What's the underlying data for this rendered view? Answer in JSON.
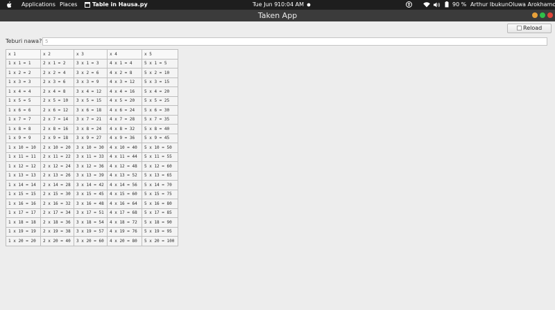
{
  "topbar": {
    "applications": "Applications",
    "places": "Places",
    "active_app": "Table in Hausa.py",
    "date": "Tue Jun 9",
    "time": "10:04 AM",
    "battery": "90 %",
    "user": "Arthur IbukunOluwa Arokhamoni"
  },
  "window": {
    "title": "Taken App",
    "buttons": [
      {
        "name": "minimize",
        "color": "#e8a13a"
      },
      {
        "name": "maximize",
        "color": "#2fbf4a"
      },
      {
        "name": "close",
        "color": "#e0463a"
      }
    ]
  },
  "toolbar": {
    "reload_label": "Reload"
  },
  "form": {
    "label": "Teburi nawa?:",
    "value": "5"
  },
  "table": {
    "headers": [
      "x 1",
      "x 2",
      "x 3",
      "x 4",
      "x 5"
    ],
    "rows": [
      [
        "1 x 1 = 1",
        "2 x 1 = 2",
        "3 x 1 = 3",
        "4 x 1 = 4",
        "5 x 1 = 5"
      ],
      [
        "1 x 2 = 2",
        "2 x 2 = 4",
        "3 x 2 = 6",
        "4 x 2 = 8",
        "5 x 2 = 10"
      ],
      [
        "1 x 3 = 3",
        "2 x 3 = 6",
        "3 x 3 = 9",
        "4 x 3 = 12",
        "5 x 3 = 15"
      ],
      [
        "1 x 4 = 4",
        "2 x 4 = 8",
        "3 x 4 = 12",
        "4 x 4 = 16",
        "5 x 4 = 20"
      ],
      [
        "1 x 5 = 5",
        "2 x 5 = 10",
        "3 x 5 = 15",
        "4 x 5 = 20",
        "5 x 5 = 25"
      ],
      [
        "1 x 6 = 6",
        "2 x 6 = 12",
        "3 x 6 = 18",
        "4 x 6 = 24",
        "5 x 6 = 30"
      ],
      [
        "1 x 7 = 7",
        "2 x 7 = 14",
        "3 x 7 = 21",
        "4 x 7 = 28",
        "5 x 7 = 35"
      ],
      [
        "1 x 8 = 8",
        "2 x 8 = 16",
        "3 x 8 = 24",
        "4 x 8 = 32",
        "5 x 8 = 40"
      ],
      [
        "1 x 9 = 9",
        "2 x 9 = 18",
        "3 x 9 = 27",
        "4 x 9 = 36",
        "5 x 9 = 45"
      ],
      [
        "1 x 10 = 10",
        "2 x 10 = 20",
        "3 x 10 = 30",
        "4 x 10 = 40",
        "5 x 10 = 50"
      ],
      [
        "1 x 11 = 11",
        "2 x 11 = 22",
        "3 x 11 = 33",
        "4 x 11 = 44",
        "5 x 11 = 55"
      ],
      [
        "1 x 12 = 12",
        "2 x 12 = 24",
        "3 x 12 = 36",
        "4 x 12 = 48",
        "5 x 12 = 60"
      ],
      [
        "1 x 13 = 13",
        "2 x 13 = 26",
        "3 x 13 = 39",
        "4 x 13 = 52",
        "5 x 13 = 65"
      ],
      [
        "1 x 14 = 14",
        "2 x 14 = 28",
        "3 x 14 = 42",
        "4 x 14 = 56",
        "5 x 14 = 70"
      ],
      [
        "1 x 15 = 15",
        "2 x 15 = 30",
        "3 x 15 = 45",
        "4 x 15 = 60",
        "5 x 15 = 75"
      ],
      [
        "1 x 16 = 16",
        "2 x 16 = 32",
        "3 x 16 = 48",
        "4 x 16 = 64",
        "5 x 16 = 80"
      ],
      [
        "1 x 17 = 17",
        "2 x 17 = 34",
        "3 x 17 = 51",
        "4 x 17 = 68",
        "5 x 17 = 85"
      ],
      [
        "1 x 18 = 18",
        "2 x 18 = 36",
        "3 x 18 = 54",
        "4 x 18 = 72",
        "5 x 18 = 90"
      ],
      [
        "1 x 19 = 19",
        "2 x 19 = 38",
        "3 x 19 = 57",
        "4 x 19 = 76",
        "5 x 19 = 95"
      ],
      [
        "1 x 20 = 20",
        "2 x 20 = 40",
        "3 x 20 = 60",
        "4 x 20 = 80",
        "5 x 20 = 100"
      ]
    ]
  }
}
